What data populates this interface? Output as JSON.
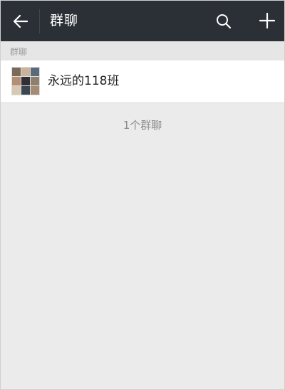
{
  "header": {
    "title": "群聊",
    "back_icon": "arrow-left-icon",
    "search_icon": "search-icon",
    "add_icon": "plus-icon"
  },
  "section": {
    "label": "群聊"
  },
  "groups": [
    {
      "name": "永远的118班",
      "avatar_icon": "group-avatar-collage",
      "avatar_colors": [
        "#7a6a5a",
        "#c9b39a",
        "#5a6b7d",
        "#b48d72",
        "#2f2f35",
        "#8f7f6e",
        "#d8c7b2",
        "#3b4653",
        "#a38b74"
      ]
    }
  ],
  "footer": {
    "count_text": "1个群聊"
  },
  "colors": {
    "topbar": "#2b3036",
    "background": "#ebebeb",
    "row": "#ffffff"
  }
}
